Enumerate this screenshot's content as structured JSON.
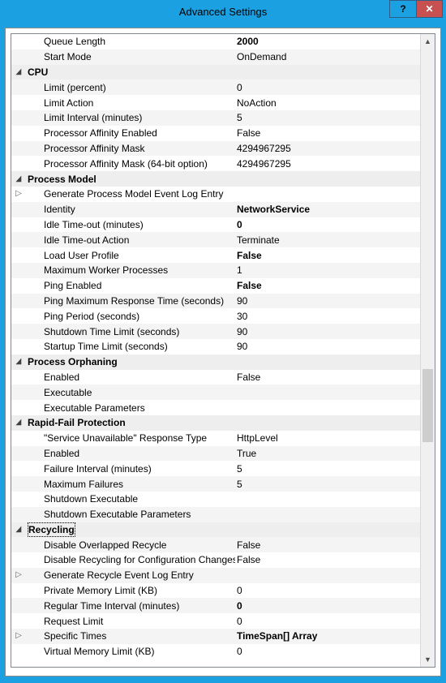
{
  "window": {
    "title": "Advanced Settings",
    "help": "?",
    "close": "✕"
  },
  "rows": [
    {
      "type": "prop",
      "label": "Queue Length",
      "value": "2000",
      "bold": true
    },
    {
      "type": "prop",
      "label": "Start Mode",
      "value": "OnDemand",
      "alt": true
    },
    {
      "type": "header",
      "label": "CPU",
      "glyph": "expanded"
    },
    {
      "type": "prop",
      "label": "Limit (percent)",
      "value": "0",
      "alt": true
    },
    {
      "type": "prop",
      "label": "Limit Action",
      "value": "NoAction"
    },
    {
      "type": "prop",
      "label": "Limit Interval (minutes)",
      "value": "5",
      "alt": true
    },
    {
      "type": "prop",
      "label": "Processor Affinity Enabled",
      "value": "False"
    },
    {
      "type": "prop",
      "label": "Processor Affinity Mask",
      "value": "4294967295",
      "alt": true
    },
    {
      "type": "prop",
      "label": "Processor Affinity Mask (64-bit option)",
      "value": "4294967295"
    },
    {
      "type": "header",
      "label": "Process Model",
      "glyph": "expanded"
    },
    {
      "type": "expandable",
      "label": "Generate Process Model Event Log Entry",
      "value": "",
      "glyph": "collapsed"
    },
    {
      "type": "prop",
      "label": "Identity",
      "value": "NetworkService",
      "bold": true,
      "alt": true
    },
    {
      "type": "prop",
      "label": "Idle Time-out (minutes)",
      "value": "0",
      "bold": true
    },
    {
      "type": "prop",
      "label": "Idle Time-out Action",
      "value": "Terminate",
      "alt": true
    },
    {
      "type": "prop",
      "label": "Load User Profile",
      "value": "False",
      "bold": true
    },
    {
      "type": "prop",
      "label": "Maximum Worker Processes",
      "value": "1",
      "alt": true
    },
    {
      "type": "prop",
      "label": "Ping Enabled",
      "value": "False",
      "bold": true
    },
    {
      "type": "prop",
      "label": "Ping Maximum Response Time (seconds)",
      "value": "90",
      "alt": true
    },
    {
      "type": "prop",
      "label": "Ping Period (seconds)",
      "value": "30"
    },
    {
      "type": "prop",
      "label": "Shutdown Time Limit (seconds)",
      "value": "90",
      "alt": true
    },
    {
      "type": "prop",
      "label": "Startup Time Limit (seconds)",
      "value": "90"
    },
    {
      "type": "header",
      "label": "Process Orphaning",
      "glyph": "expanded"
    },
    {
      "type": "prop",
      "label": "Enabled",
      "value": "False"
    },
    {
      "type": "prop",
      "label": "Executable",
      "value": "",
      "alt": true
    },
    {
      "type": "prop",
      "label": "Executable Parameters",
      "value": ""
    },
    {
      "type": "header",
      "label": "Rapid-Fail Protection",
      "glyph": "expanded"
    },
    {
      "type": "prop",
      "label": "\"Service Unavailable\" Response Type",
      "value": "HttpLevel"
    },
    {
      "type": "prop",
      "label": "Enabled",
      "value": "True",
      "alt": true
    },
    {
      "type": "prop",
      "label": "Failure Interval (minutes)",
      "value": "5"
    },
    {
      "type": "prop",
      "label": "Maximum Failures",
      "value": "5",
      "alt": true
    },
    {
      "type": "prop",
      "label": "Shutdown Executable",
      "value": ""
    },
    {
      "type": "prop",
      "label": "Shutdown Executable Parameters",
      "value": "",
      "alt": true
    },
    {
      "type": "header",
      "label": "Recycling",
      "glyph": "expanded",
      "focused": true
    },
    {
      "type": "prop",
      "label": "Disable Overlapped Recycle",
      "value": "False",
      "alt": true
    },
    {
      "type": "prop",
      "label": "Disable Recycling for Configuration Changes",
      "value": "False"
    },
    {
      "type": "expandable",
      "label": "Generate Recycle Event Log Entry",
      "value": "",
      "glyph": "collapsed",
      "alt": true
    },
    {
      "type": "prop",
      "label": "Private Memory Limit (KB)",
      "value": "0"
    },
    {
      "type": "prop",
      "label": "Regular Time Interval (minutes)",
      "value": "0",
      "bold": true,
      "alt": true
    },
    {
      "type": "prop",
      "label": "Request Limit",
      "value": "0"
    },
    {
      "type": "expandable",
      "label": "Specific Times",
      "value": "TimeSpan[] Array",
      "bold": true,
      "glyph": "collapsed",
      "alt": true
    },
    {
      "type": "prop",
      "label": "Virtual Memory Limit (KB)",
      "value": "0"
    }
  ]
}
